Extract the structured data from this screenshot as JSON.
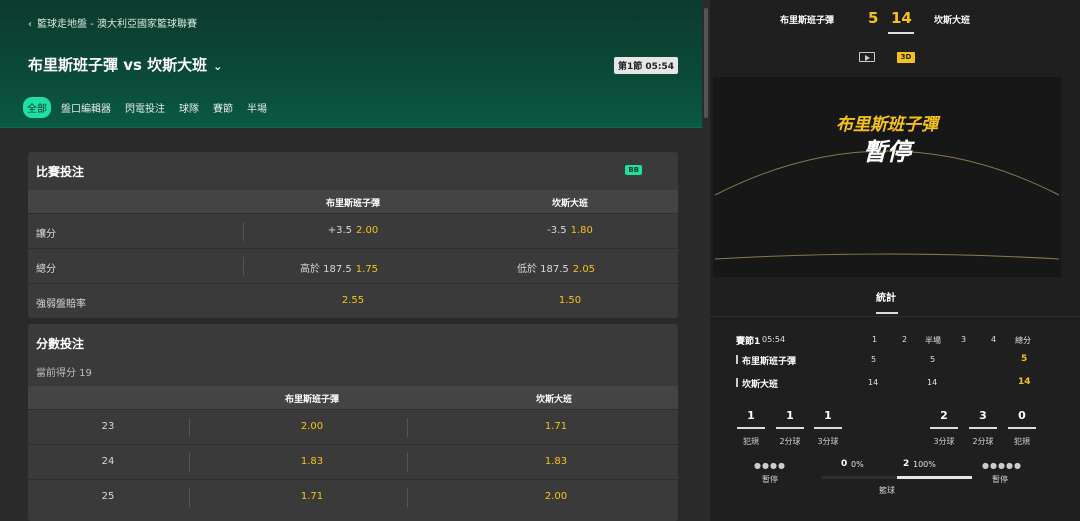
{
  "header": {
    "breadcrumb": "籃球走地盤 - 澳大利亞國家籃球聯賽",
    "match_title": "布里斯班子彈 vs 坎斯大班",
    "clock": "第1節 05:54",
    "tabs": [
      "全部",
      "盤口編輯器",
      "閃電投注",
      "球隊",
      "賽節",
      "半場"
    ]
  },
  "match_bets": {
    "title": "比賽投注",
    "badge": "BB",
    "col_home": "布里斯班子彈",
    "col_away": "坎斯大班",
    "rows": [
      {
        "label": "讓分",
        "home_hcp": "+3.5",
        "home_odds": "2.00",
        "away_hcp": "-3.5",
        "away_odds": "1.80"
      },
      {
        "label": "總分",
        "home_hcp": "高於 187.5",
        "home_odds": "1.75",
        "away_hcp": "低於 187.5",
        "away_odds": "2.05"
      },
      {
        "label": "強弱盤賠率",
        "home_hcp": "",
        "home_odds": "2.55",
        "away_hcp": "",
        "away_odds": "1.50"
      }
    ]
  },
  "score_bets": {
    "title": "分數投注",
    "current": "當前得分 19",
    "col_home": "布里斯班子彈",
    "col_away": "坎斯大班",
    "rows": [
      {
        "score": "23",
        "home": "2.00",
        "away": "1.71"
      },
      {
        "score": "24",
        "home": "1.83",
        "away": "1.83"
      },
      {
        "score": "25",
        "home": "1.71",
        "away": "2.00"
      }
    ]
  },
  "scoreboard": {
    "home": "布里斯班子彈",
    "away": "坎斯大班",
    "home_score": "5",
    "away_score": "14",
    "viz_team": "布里斯班子彈",
    "viz_state": "暫停",
    "icon_play": "video-icon",
    "icon_3d": "3D"
  },
  "stats": {
    "tab": "統計",
    "period_label": "賽節1",
    "period_time": "05:54",
    "cols": [
      "1",
      "2",
      "半場",
      "3",
      "4",
      "總分"
    ],
    "home": {
      "name": "布里斯班子彈",
      "q1": "5",
      "half": "5",
      "total": "5"
    },
    "away": {
      "name": "坎斯大班",
      "q1": "14",
      "half": "14",
      "total": "14"
    },
    "home_boxes": [
      {
        "value": "1",
        "label": "犯規"
      },
      {
        "value": "1",
        "label": "2分球"
      },
      {
        "value": "1",
        "label": "3分球"
      }
    ],
    "away_boxes": [
      {
        "value": "2",
        "label": "3分球"
      },
      {
        "value": "3",
        "label": "2分球"
      },
      {
        "value": "0",
        "label": "犯規"
      }
    ],
    "timeout_label": "暫停",
    "possession": {
      "home_value": "0",
      "home_pct": "0%",
      "away_value": "2",
      "away_pct": "100%",
      "label": "籃球"
    }
  }
}
